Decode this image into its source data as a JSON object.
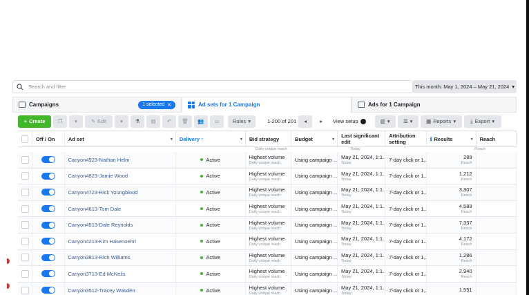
{
  "search": {
    "placeholder": "Search and filter"
  },
  "date_range": {
    "label": "This month: May 1, 2024 – May 21, 2024"
  },
  "tabs": {
    "campaigns": "Campaigns",
    "selected_pill": "1 selected",
    "adsets": "Ad sets for 1 Campaign",
    "ads": "Ads for 1 Campaign"
  },
  "toolbar": {
    "create": "Create",
    "edit": "Edit",
    "rules": "Rules",
    "pager": "1-200 of 201",
    "view_setup": "View setup",
    "reports": "Reports",
    "export": "Export"
  },
  "columns": {
    "offon": "Off / On",
    "adset": "Ad set",
    "delivery": "Delivery ↑",
    "bid": "Bid strategy",
    "budget": "Budget",
    "last_edit": "Last significant edit",
    "attribution": "Attribution setting",
    "results": "Results",
    "reach": "Reach"
  },
  "ghost": {
    "bid": "Daily unique reach",
    "edit": "Today",
    "results": "Reach"
  },
  "rows": [
    {
      "name": "Canyon4923-Nathan Helm",
      "delivery": "Active",
      "bid": "Highest volume",
      "bid_sub": "Daily unique reach",
      "budget": "Using campaign ...",
      "edit": "May 21, 2024, 1:1...",
      "edit_sub": "Today",
      "attr": "7-day click or 1...",
      "results": "289",
      "results_sub": "Reach"
    },
    {
      "name": "Canyon4823-Jamie Wood",
      "delivery": "Active",
      "bid": "Highest volume",
      "bid_sub": "Daily unique reach",
      "budget": "Using campaign ...",
      "edit": "May 21, 2024, 1:1...",
      "edit_sub": "Today",
      "attr": "7-day click or 1...",
      "results": "1,212",
      "results_sub": "Reach"
    },
    {
      "name": "Canyon4723-Rick Youngblood",
      "delivery": "Active",
      "bid": "Highest volume",
      "bid_sub": "Daily unique reach",
      "budget": "Using campaign ...",
      "edit": "May 21, 2024, 1:1...",
      "edit_sub": "Today",
      "attr": "7-day click or 1...",
      "results": "3,307",
      "results_sub": "Reach"
    },
    {
      "name": "Canyon4613-Tom Dale",
      "delivery": "Active",
      "bid": "Highest volume",
      "bid_sub": "Daily unique reach",
      "budget": "Using campaign ...",
      "edit": "May 21, 2024, 1:1...",
      "edit_sub": "Today",
      "attr": "7-day click or 1...",
      "results": "4,589",
      "results_sub": "Reach"
    },
    {
      "name": "Canyon4513-Dale Reynolds",
      "delivery": "Active",
      "bid": "Highest volume",
      "bid_sub": "Daily unique reach",
      "budget": "Using campaign ...",
      "edit": "May 21, 2024, 1:1...",
      "edit_sub": "Today",
      "attr": "7-day click or 1...",
      "results": "7,337",
      "results_sub": "Reach"
    },
    {
      "name": "Canyon4213-Kim Hasenoehrl",
      "delivery": "Active",
      "bid": "Highest volume",
      "bid_sub": "Daily unique reach",
      "budget": "Using campaign ...",
      "edit": "May 21, 2024, 1:1...",
      "edit_sub": "Today",
      "attr": "7-day click or 1...",
      "results": "4,172",
      "results_sub": "Reach"
    },
    {
      "name": "Canyon3813-Rich Williams",
      "delivery": "Active",
      "bid": "Highest volume",
      "bid_sub": "Daily unique reach",
      "budget": "Using campaign ...",
      "edit": "May 21, 2024, 1:1...",
      "edit_sub": "Today",
      "attr": "7-day click or 1...",
      "results": "1,286",
      "results_sub": "Reach"
    },
    {
      "name": "Canyon3713-Ed McNelis",
      "delivery": "Active",
      "bid": "Highest volume",
      "bid_sub": "Daily unique reach",
      "budget": "Using campaign ...",
      "edit": "May 21, 2024, 1:1...",
      "edit_sub": "Today",
      "attr": "7-day click or 1...",
      "results": "2,940",
      "results_sub": "Reach"
    },
    {
      "name": "Canyon3512-Tracey Wasden",
      "delivery": "Active",
      "bid": "Highest volume",
      "bid_sub": "Daily unique reach",
      "budget": "Using campaign ...",
      "edit": "May 21, 2024, 1:1...",
      "edit_sub": "Today",
      "attr": "7-day click or 1...",
      "results": "1,551",
      "results_sub": ""
    }
  ],
  "colors": {
    "accent": "#1877f2",
    "create": "#42b72a",
    "link": "#385898",
    "active_dot": "#42b72a"
  }
}
